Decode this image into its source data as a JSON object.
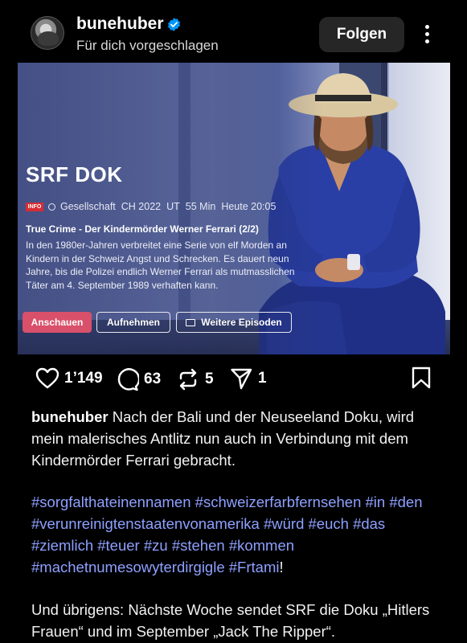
{
  "post": {
    "username": "bunehuber",
    "subtitle": "Für dich vorgeschlagen",
    "follow_label": "Folgen",
    "verified": true
  },
  "tv": {
    "channel_title": "SRF DOK",
    "logo_text": "INFO",
    "genre": "Gesellschaft",
    "country_year": "CH 2022",
    "ut": "UT",
    "duration": "55 Min",
    "airtime": "Heute 20:05",
    "episode_title": "True Crime - Der Kindermörder Werner Ferrari (2/2)",
    "description": "In den 1980er-Jahren verbreitet eine Serie von elf Morden an Kindern in der Schweiz Angst und Schrecken. Es dauert neun Jahre, bis die Polizei endlich Werner Ferrari als mutmasslichen Täter am 4. September 1989 verhaften kann.",
    "btn_watch": "Anschauen",
    "btn_record": "Aufnehmen",
    "btn_episodes": "Weitere Episoden"
  },
  "actions": {
    "likes": "1’149",
    "comments": "63",
    "reposts": "5",
    "shares": "1"
  },
  "caption": {
    "username": "bunehuber",
    "text": " Nach der Bali und der Neuseeland Doku, wird mein malerisches Antlitz nun auch in Verbindung mit dem Kindermörder Ferrari gebracht.",
    "hashtags": [
      "#sorgfalthateinennamen",
      "#schweizerfarbfernsehen",
      "#in",
      "#den",
      "#verunreinigtenstaatenvonamerika",
      "#würd",
      "#euch",
      "#das",
      "#ziemlich",
      "#teuer",
      "#zu",
      "#stehen",
      "#kommen",
      "#machetnumesowyterdirgigle",
      "#Frtami"
    ],
    "hashtag_end": "!",
    "paragraph2": "Und übrigens: Nächste Woche sendet SRF die Doku „Hitlers Frauen“ und im September „Jack The Ripper“."
  },
  "colors": {
    "background": "#000000",
    "hashtag": "#8ea0ff",
    "verified": "#0095f6",
    "watch_button": "#d9506a"
  },
  "icons": [
    "avatar",
    "verified-icon",
    "more-icon",
    "heart-icon",
    "comment-icon",
    "repost-icon",
    "share-icon",
    "bookmark-icon"
  ]
}
